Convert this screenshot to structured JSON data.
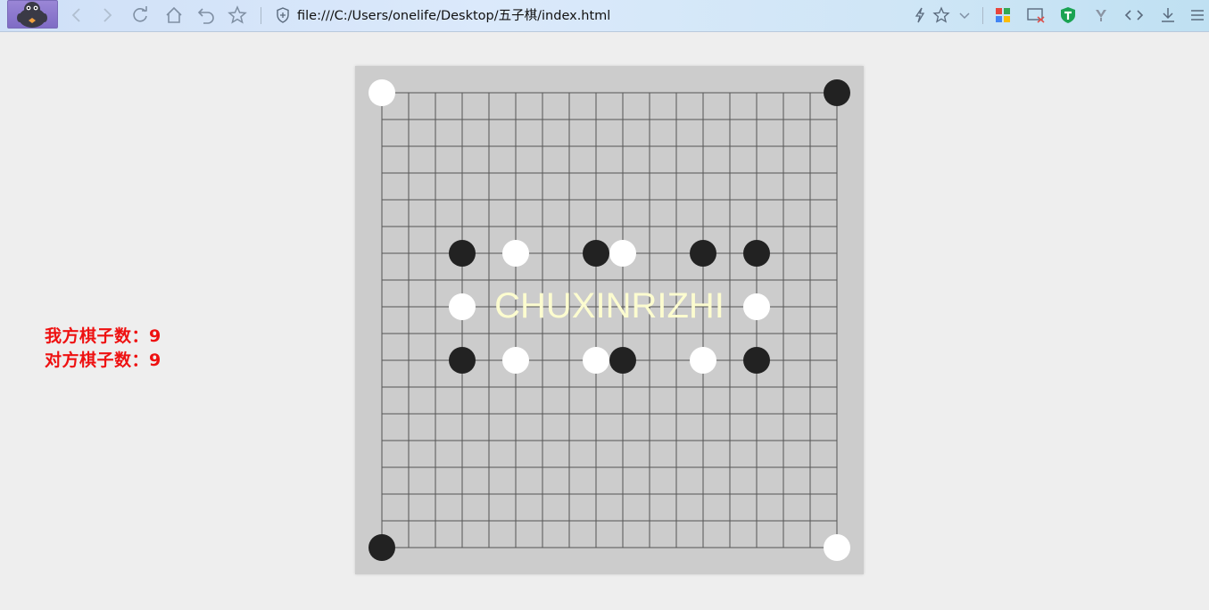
{
  "browser": {
    "url": "file:///C:/Users/onelife/Desktop/五子棋/index.html",
    "icons": [
      "back-icon",
      "forward-icon",
      "refresh-icon",
      "home-icon",
      "undo-icon",
      "star-icon",
      "shield-icon",
      "lightning-icon",
      "bookmark-star-icon",
      "chevron-down-icon",
      "apps-icon",
      "screenshot-icon",
      "security-shield-icon",
      "extension-icon",
      "devtools-icon",
      "download-icon",
      "menu-icon"
    ]
  },
  "board": {
    "size": 18,
    "watermark": "CHUXINRIZHI",
    "colors": {
      "background": "#cccccc",
      "line": "#555555",
      "black": "#222222",
      "white": "#ffffff",
      "watermark": "#fcfccf"
    },
    "stones": [
      {
        "col": 0,
        "row": 0,
        "color": "white"
      },
      {
        "col": 17,
        "row": 0,
        "color": "black"
      },
      {
        "col": 3,
        "row": 6,
        "color": "black"
      },
      {
        "col": 5,
        "row": 6,
        "color": "white"
      },
      {
        "col": 8,
        "row": 6,
        "color": "black"
      },
      {
        "col": 9,
        "row": 6,
        "color": "white"
      },
      {
        "col": 12,
        "row": 6,
        "color": "black"
      },
      {
        "col": 14,
        "row": 6,
        "color": "black"
      },
      {
        "col": 3,
        "row": 8,
        "color": "white"
      },
      {
        "col": 14,
        "row": 8,
        "color": "white"
      },
      {
        "col": 3,
        "row": 10,
        "color": "black"
      },
      {
        "col": 5,
        "row": 10,
        "color": "white"
      },
      {
        "col": 8,
        "row": 10,
        "color": "white"
      },
      {
        "col": 9,
        "row": 10,
        "color": "black"
      },
      {
        "col": 12,
        "row": 10,
        "color": "white"
      },
      {
        "col": 14,
        "row": 10,
        "color": "black"
      },
      {
        "col": 0,
        "row": 17,
        "color": "black"
      },
      {
        "col": 17,
        "row": 17,
        "color": "white"
      }
    ]
  },
  "score": {
    "mine_label": "我方棋子数：9",
    "opponent_label": "对方棋子数：9",
    "color": "#ee1111"
  }
}
